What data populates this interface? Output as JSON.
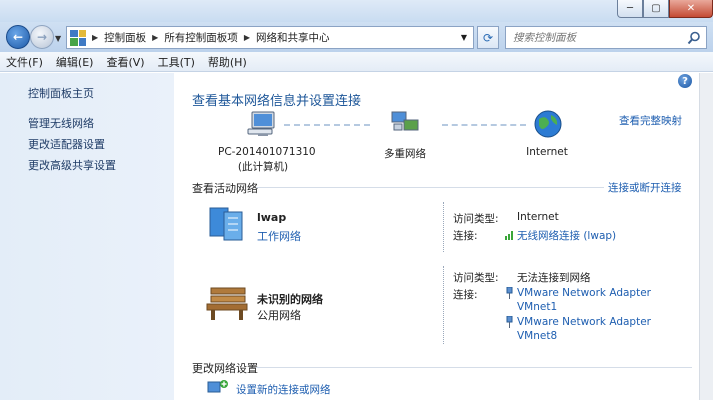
{
  "window": {
    "min": "─",
    "max": "▢",
    "close": "✕"
  },
  "address": {
    "crumbs": [
      "控制面板",
      "所有控制面板项",
      "网络和共享中心"
    ]
  },
  "search": {
    "placeholder": "搜索控制面板"
  },
  "menu": [
    {
      "label": "文件(F)"
    },
    {
      "label": "编辑(E)"
    },
    {
      "label": "查看(V)"
    },
    {
      "label": "工具(T)"
    },
    {
      "label": "帮助(H)"
    }
  ],
  "sidebar": {
    "items": [
      {
        "label": "控制面板主页"
      },
      {
        "label": "管理无线网络"
      },
      {
        "label": "更改适配器设置"
      },
      {
        "label": "更改高级共享设置"
      }
    ]
  },
  "main": {
    "heading": "查看基本网络信息并设置连接",
    "full_map_link": "查看完整映射",
    "map": {
      "computer": {
        "name": "PC-201401071310",
        "sub": "(此计算机)"
      },
      "multi": {
        "name": "多重网络"
      },
      "internet": {
        "name": "Internet"
      }
    },
    "active_section": {
      "title": "查看活动网络",
      "link": "连接或断开连接"
    },
    "networks": [
      {
        "name": "lwap",
        "type": "工作网络",
        "access_label": "访问类型:",
        "access_value": "Internet",
        "conn_label": "连接:",
        "conn_values": [
          "无线网络连接 (lwap)"
        ]
      },
      {
        "name": "未识别的网络",
        "type": "公用网络",
        "access_label": "访问类型:",
        "access_value": "无法连接到网络",
        "conn_label": "连接:",
        "conn_values": [
          "VMware Network Adapter",
          "VMnet1",
          "VMware Network Adapter",
          "VMnet8"
        ]
      }
    ],
    "change_section": {
      "title": "更改网络设置",
      "items": [
        {
          "label": "设置新的连接或网络"
        }
      ]
    }
  },
  "colors": {
    "link": "#1e5eb0",
    "heading": "#1e5799",
    "sidebar_bg": "#e3edf8"
  }
}
